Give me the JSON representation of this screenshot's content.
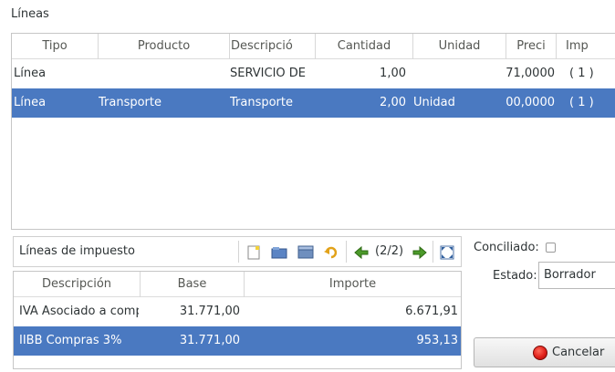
{
  "lines": {
    "title": "Líneas",
    "columns": [
      "Tipo",
      "Producto",
      "Descripció",
      "Cantidad",
      "Unidad",
      "Preci",
      "Imp"
    ],
    "rows": [
      {
        "tipo": "Línea",
        "producto": "",
        "descripcion": "SERVICIO DE ",
        "cantidad": "1,00",
        "unidad": "",
        "precio": "71,0000",
        "imp": "( 1 )",
        "selected": false
      },
      {
        "tipo": "Línea",
        "producto": "Transporte",
        "descripcion": "Transporte",
        "cantidad": "2,00",
        "unidad": "Unidad",
        "precio": "00,0000",
        "imp": "( 1 )",
        "selected": true
      }
    ]
  },
  "tax_lines": {
    "title": "Líneas de impuesto",
    "page_indicator": "(2/2)",
    "columns": [
      "Descripción",
      "Base",
      "Importe"
    ],
    "rows": [
      {
        "descripcion": "IVA Asociado a comp",
        "base": "31.771,00",
        "importe": "6.671,91",
        "selected": false
      },
      {
        "descripcion": "IIBB Compras 3%",
        "base": "31.771,00",
        "importe": "953,13",
        "selected": true
      }
    ],
    "toolbar_icons": [
      "new-record-icon",
      "open-record-icon",
      "save-record-icon",
      "undo-icon",
      "previous-icon",
      "next-icon",
      "switch-view-icon"
    ]
  },
  "form": {
    "conciliado_label": "Conciliado:",
    "estado_label": "Estado:",
    "estado_value": "Borrador",
    "cancel_label": "Cancelar"
  },
  "colors": {
    "selection": "#4a79c1",
    "border": "#c6c6c6",
    "cancel_icon": "#e0201a"
  }
}
